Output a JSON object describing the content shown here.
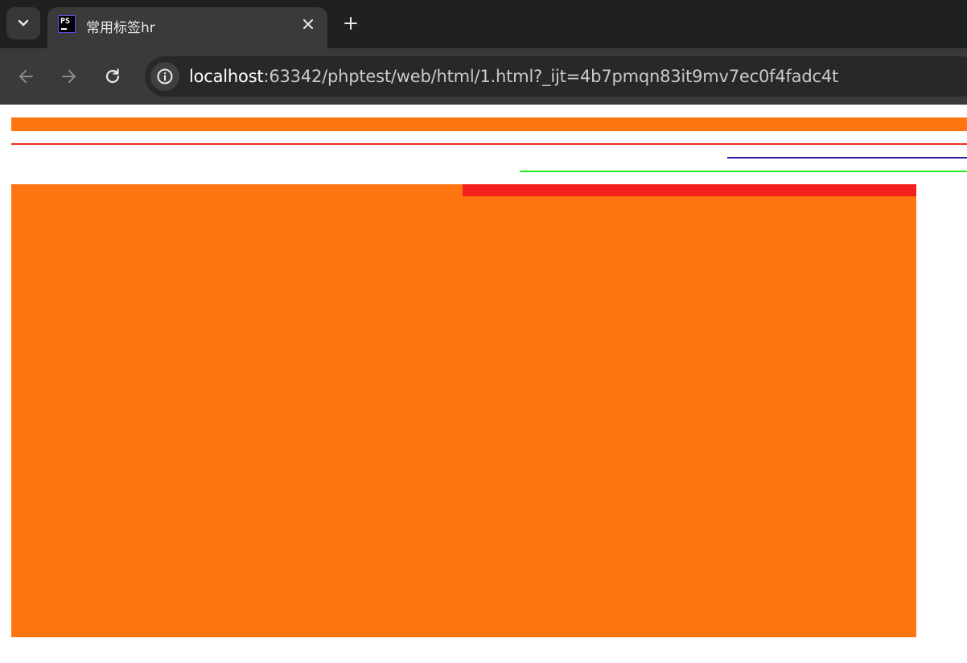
{
  "browser": {
    "tab": {
      "title": "常用标签hr",
      "favicon_text": "PS",
      "favicon_icon": "phpstorm-icon"
    },
    "address_bar": {
      "host": "localhost",
      "path": ":63342/phptest/web/html/1.html?_ijt=4b7pmqn83it9mv7ec0f4fadc4t"
    },
    "icons": {
      "tab_menu": "chevron-down-icon",
      "close_tab": "close-icon",
      "new_tab": "plus-icon",
      "back": "arrow-left-icon",
      "forward": "arrow-right-icon",
      "reload": "reload-icon",
      "site_info": "info-icon"
    }
  },
  "page": {
    "rules": [
      {
        "name": "hr-1",
        "color": "#ff7512"
      },
      {
        "name": "hr-2",
        "color": "#ee2a22"
      },
      {
        "name": "hr-3",
        "color": "#2a1aa8"
      },
      {
        "name": "hr-4",
        "color": "#22ee22"
      },
      {
        "name": "hr-5",
        "color": "#ff7512",
        "top_border_color": "#f5201e"
      }
    ]
  },
  "colors": {
    "chrome_dark": "#1f2020",
    "chrome_toolbar": "#3a3a3a",
    "omnibox": "#282828"
  }
}
